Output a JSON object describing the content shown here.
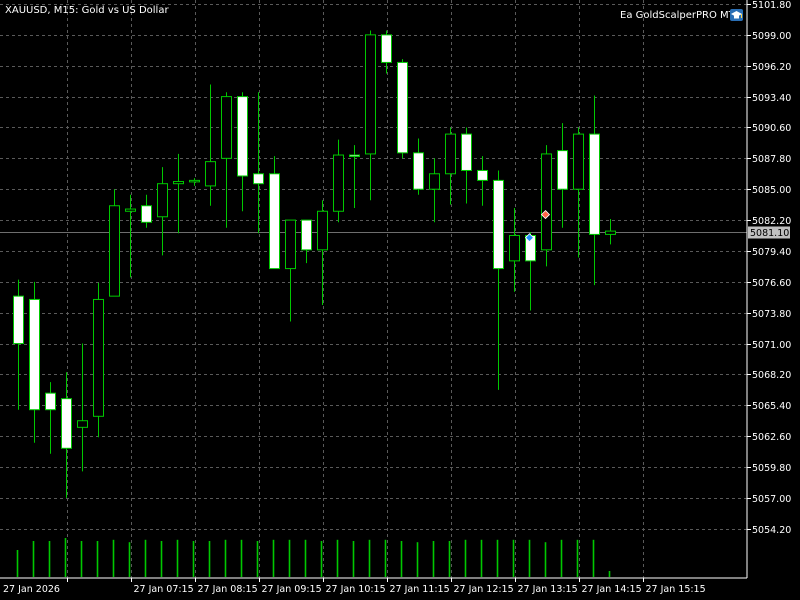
{
  "window": {
    "symbol_title": "XAUUSD, M15:  Gold vs US Dollar",
    "ea_label": "Ea GoldScalperPRO MT5",
    "ea_icon": "graduation-cap-icon"
  },
  "colors": {
    "background": "#000000",
    "grid": "#5a5a5a",
    "axis": "#ffffff",
    "candle_outline": "#00c800",
    "bull_body": "#000000",
    "bear_body": "#ffffff",
    "volume": "#00c800",
    "current_price_line": "#6e6e6e",
    "price_tag_bg": "#c0c0c0",
    "buy_arrow": "#1e90ff",
    "sell_arrow": "#ff6347"
  },
  "current_price": {
    "value": 5081.1,
    "label": "5081.10"
  },
  "chart_data": {
    "type": "candlestick",
    "symbol": "XAUUSD",
    "timeframe": "M15",
    "price_axis": {
      "ylim": [
        5052.5,
        5101.8
      ],
      "ticks": [
        "5101.80",
        "5099.00",
        "5096.20",
        "5093.40",
        "5090.60",
        "5087.80",
        "5085.00",
        "5082.20",
        "5079.40",
        "5076.60",
        "5073.80",
        "5071.00",
        "5068.20",
        "5065.40",
        "5062.60",
        "5059.80",
        "5057.00",
        "5054.20"
      ]
    },
    "time_axis": {
      "labels": [
        "27 Jan 2026",
        "27 Jan 07:15",
        "27 Jan 08:15",
        "27 Jan 09:15",
        "27 Jan 10:15",
        "27 Jan 11:15",
        "27 Jan 12:15",
        "27 Jan 13:15",
        "27 Jan 14:15",
        "27 Jan 15:15"
      ]
    },
    "grid": true,
    "candles": [
      {
        "o": 5075.3,
        "h": 5076.8,
        "l": 5065.0,
        "c": 5071.0
      },
      {
        "o": 5075.0,
        "h": 5076.6,
        "l": 5062.0,
        "c": 5065.0
      },
      {
        "o": 5066.5,
        "h": 5067.5,
        "l": 5061.0,
        "c": 5065.0
      },
      {
        "o": 5066.0,
        "h": 5068.4,
        "l": 5057.0,
        "c": 5061.5
      },
      {
        "o": 5063.4,
        "h": 5071.0,
        "l": 5059.4,
        "c": 5064.0
      },
      {
        "o": 5064.4,
        "h": 5076.5,
        "l": 5062.5,
        "c": 5075.0
      },
      {
        "o": 5075.3,
        "h": 5085.0,
        "l": 5076.5,
        "c": 5083.5
      },
      {
        "o": 5083.0,
        "h": 5084.5,
        "l": 5077.0,
        "c": 5083.2
      },
      {
        "o": 5083.5,
        "h": 5084.5,
        "l": 5081.5,
        "c": 5082.0
      },
      {
        "o": 5082.5,
        "h": 5087.0,
        "l": 5079.0,
        "c": 5085.5
      },
      {
        "o": 5085.5,
        "h": 5088.2,
        "l": 5081.0,
        "c": 5085.7
      },
      {
        "o": 5085.7,
        "h": 5086.0,
        "l": 5085.3,
        "c": 5085.8
      },
      {
        "o": 5085.3,
        "h": 5094.5,
        "l": 5083.5,
        "c": 5087.5
      },
      {
        "o": 5087.8,
        "h": 5093.8,
        "l": 5081.5,
        "c": 5093.4
      },
      {
        "o": 5093.4,
        "h": 5093.8,
        "l": 5083.0,
        "c": 5086.2
      },
      {
        "o": 5086.4,
        "h": 5093.8,
        "l": 5081.0,
        "c": 5085.5
      },
      {
        "o": 5086.4,
        "h": 5088.0,
        "l": 5079.6,
        "c": 5077.8
      },
      {
        "o": 5077.8,
        "h": 5079.7,
        "l": 5073.0,
        "c": 5082.2
      },
      {
        "o": 5082.2,
        "h": 5082.2,
        "l": 5078.3,
        "c": 5079.5
      },
      {
        "o": 5079.5,
        "h": 5084.0,
        "l": 5074.5,
        "c": 5083.0
      },
      {
        "o": 5083.0,
        "h": 5089.5,
        "l": 5082.0,
        "c": 5088.1
      },
      {
        "o": 5088.1,
        "h": 5089.0,
        "l": 5083.3,
        "c": 5088.0
      },
      {
        "o": 5088.2,
        "h": 5099.4,
        "l": 5084.0,
        "c": 5099.0
      },
      {
        "o": 5099.0,
        "h": 5099.4,
        "l": 5095.5,
        "c": 5096.5
      },
      {
        "o": 5096.5,
        "h": 5096.8,
        "l": 5087.8,
        "c": 5088.3
      },
      {
        "o": 5088.3,
        "h": 5089.6,
        "l": 5084.5,
        "c": 5085.0
      },
      {
        "o": 5085.0,
        "h": 5087.8,
        "l": 5082.0,
        "c": 5086.4
      },
      {
        "o": 5086.4,
        "h": 5090.6,
        "l": 5083.6,
        "c": 5090.0
      },
      {
        "o": 5090.0,
        "h": 5090.6,
        "l": 5083.7,
        "c": 5086.7
      },
      {
        "o": 5086.7,
        "h": 5088.0,
        "l": 5083.5,
        "c": 5085.8
      },
      {
        "o": 5085.8,
        "h": 5086.7,
        "l": 5066.8,
        "c": 5077.8
      },
      {
        "o": 5078.5,
        "h": 5083.3,
        "l": 5075.7,
        "c": 5080.8
      },
      {
        "o": 5080.8,
        "h": 5081.1,
        "l": 5074.0,
        "c": 5078.5
      },
      {
        "o": 5079.5,
        "h": 5089.0,
        "l": 5078.0,
        "c": 5088.2
      },
      {
        "o": 5088.5,
        "h": 5091.0,
        "l": 5081.5,
        "c": 5085.0
      },
      {
        "o": 5085.0,
        "h": 5090.6,
        "l": 5078.8,
        "c": 5090.0
      },
      {
        "o": 5090.0,
        "h": 5093.5,
        "l": 5076.3,
        "c": 5080.9
      },
      {
        "o": 5080.9,
        "h": 5082.3,
        "l": 5080.0,
        "c": 5081.2
      }
    ],
    "volume_relative": [
      0.45,
      0.6,
      0.6,
      0.65,
      0.6,
      0.6,
      0.62,
      0.58,
      0.62,
      0.6,
      0.62,
      0.6,
      0.6,
      0.62,
      0.62,
      0.6,
      0.62,
      0.62,
      0.62,
      0.6,
      0.62,
      0.6,
      0.62,
      0.62,
      0.6,
      0.58,
      0.6,
      0.6,
      0.62,
      0.62,
      0.62,
      0.62,
      0.62,
      0.58,
      0.62,
      0.62,
      0.62,
      0.1
    ],
    "markers": [
      {
        "type": "buy",
        "candle": 32,
        "price": 5080.6
      },
      {
        "type": "sell",
        "candle": 33,
        "price": 5082.7
      }
    ]
  }
}
